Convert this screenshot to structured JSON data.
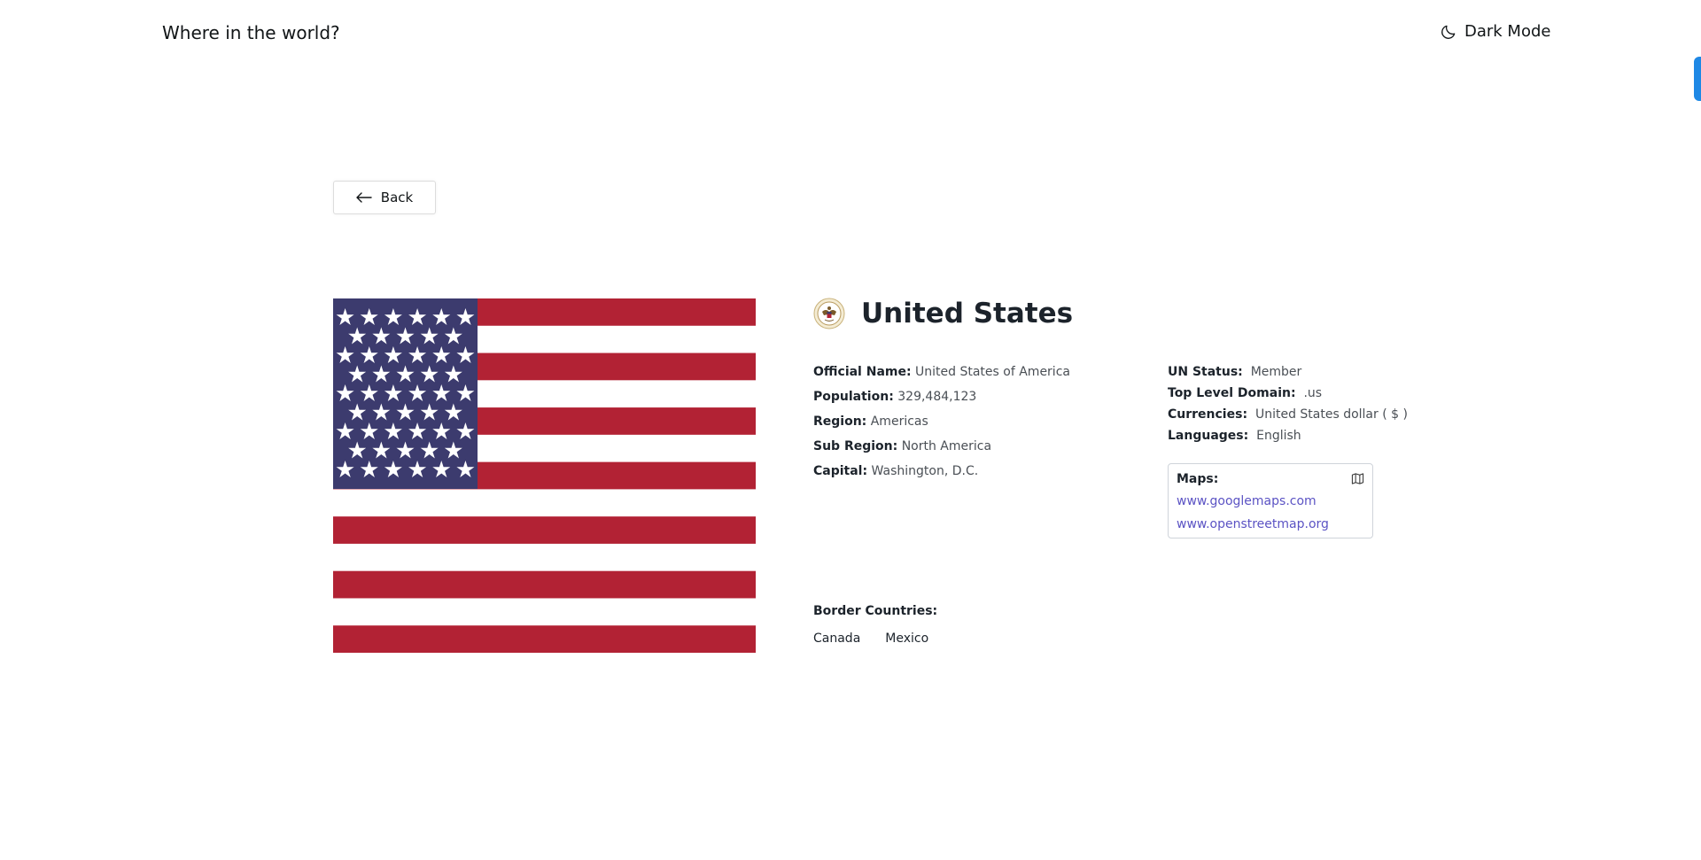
{
  "header": {
    "brand": "Where in the world?",
    "mode_toggle_label": "Dark Mode",
    "mode_icon": "moon-icon"
  },
  "back_button": {
    "label": "Back",
    "icon": "arrow-left-icon"
  },
  "country": {
    "name": "United States",
    "flag_image": "flag-usa",
    "coat_of_arms": "seal-icon",
    "details_left": [
      {
        "label": "Official Name:",
        "value": "United States of America"
      },
      {
        "label": "Population:",
        "value": "329,484,123"
      },
      {
        "label": "Region:",
        "value": "Americas"
      },
      {
        "label": "Sub Region:",
        "value": "North America"
      },
      {
        "label": "Capital:",
        "value": "Washington, D.C."
      }
    ],
    "details_right": [
      {
        "label": "UN Status:",
        "value": "Member"
      },
      {
        "label": "Top Level Domain:",
        "value": ".us"
      },
      {
        "label": "Currencies:",
        "value": "United States dollar ( $ )"
      },
      {
        "label": "Languages:",
        "value": "English"
      }
    ],
    "maps": {
      "title": "Maps:",
      "icon": "map-icon",
      "links": [
        "www.googlemaps.com",
        "www.openstreetmap.org"
      ]
    },
    "borders": {
      "title": "Border Countries:",
      "items": [
        "Canada",
        "Mexico"
      ]
    }
  },
  "colors": {
    "flag_red": "#b22234",
    "flag_blue": "#3c3b6e",
    "link": "#5b53c4",
    "accent": "#1e88e5"
  }
}
